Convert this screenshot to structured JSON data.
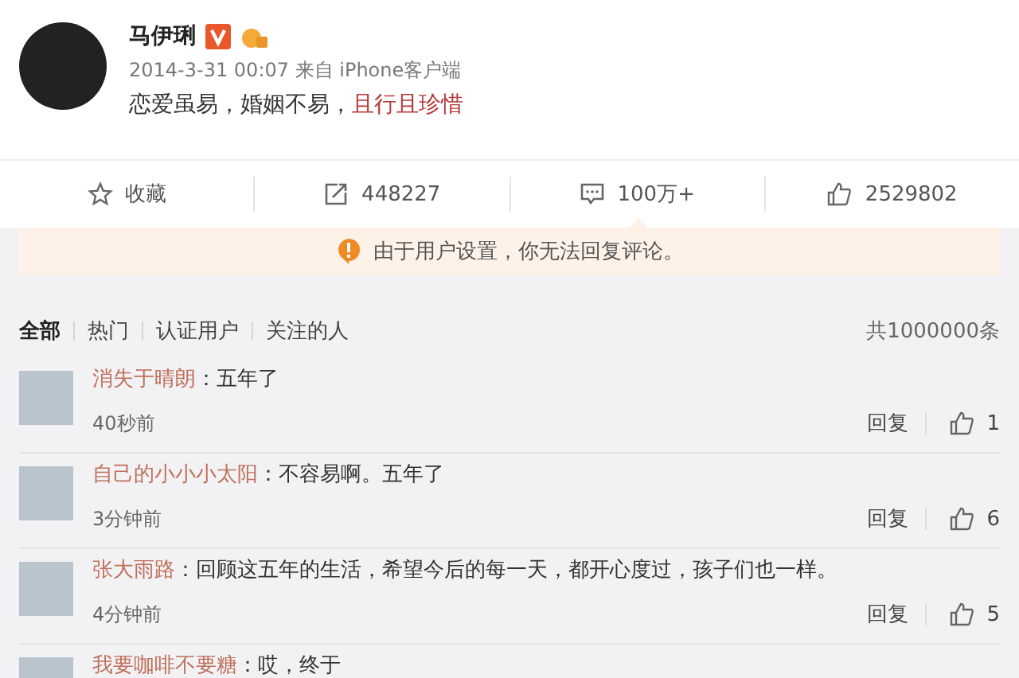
{
  "post": {
    "author": "马伊琍",
    "verified": true,
    "time": "2014-3-31 00:07",
    "source": "来自 iPhone客户端",
    "text": "恋爱虽易，婚姻不易，",
    "link": "且行且珍惜"
  },
  "actions": [
    {
      "kind": "favorite",
      "label": "收藏",
      "selected": false
    },
    {
      "kind": "repost",
      "label": "448227",
      "selected": false
    },
    {
      "kind": "comment",
      "label": "100万+",
      "selected": true
    },
    {
      "kind": "like",
      "label": "2529802",
      "selected": false
    }
  ],
  "notice": "由于用户设置，你无法回复评论。",
  "tabs": [
    {
      "label": "全部",
      "selected": true
    },
    {
      "label": "热门",
      "selected": false
    },
    {
      "label": "认证用户",
      "selected": false
    },
    {
      "label": "关注的人",
      "selected": false
    }
  ],
  "total": "共1000000条",
  "comments": [
    {
      "user": "消失于晴朗",
      "text": "：五年了",
      "time": "40秒前",
      "reply": "回复",
      "likes": "1"
    },
    {
      "user": "自己的小小小太阳",
      "text": "：不容易啊。五年了",
      "time": "3分钟前",
      "reply": "回复",
      "likes": "6"
    },
    {
      "user": "张大雨路",
      "text": "：回顾这五年的生活，希望今后的每一天，都开心度过，孩子们也一样。",
      "time": "4分钟前",
      "reply": "回复",
      "likes": "5"
    },
    {
      "user": "我要咖啡不要糖",
      "text": "：哎，终于"
    }
  ]
}
